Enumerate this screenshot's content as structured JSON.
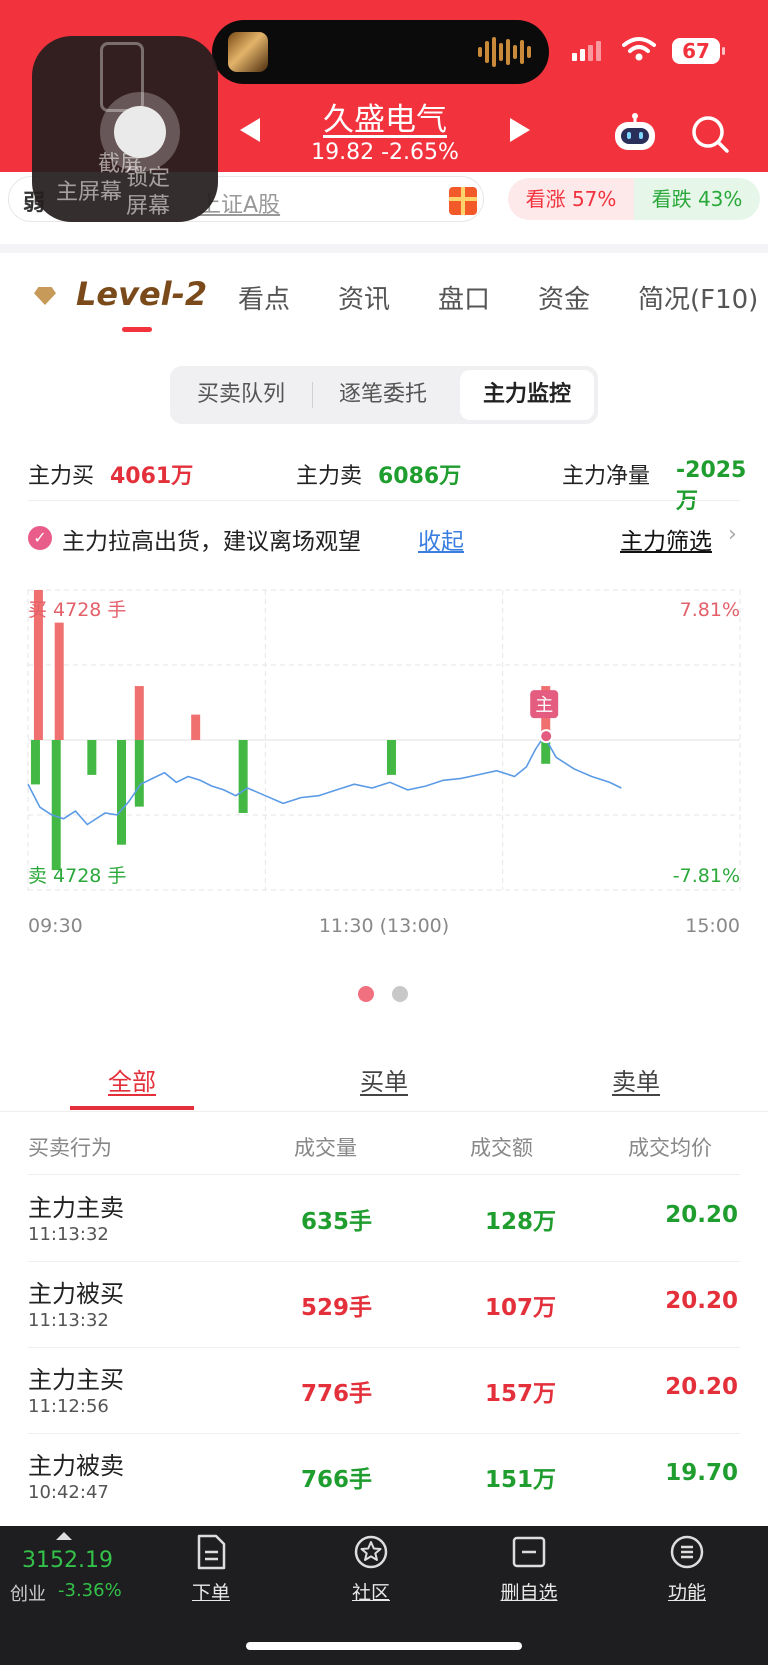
{
  "status_bar": {
    "battery": "67"
  },
  "header": {
    "stock_name": "久盛电气",
    "stock_price": "19.82 -2.65%",
    "icons": {
      "prev": "triangle-left-icon",
      "next": "triangle-right-icon",
      "assistant": "robot-icon",
      "search": "search-icon"
    }
  },
  "assistive_overlay": {
    "screenshot_label": "截屏",
    "lock_label": "锁定",
    "home_label": "主屏幕",
    "screen_label": "屏幕"
  },
  "search_strip": {
    "lead_char": "弱",
    "placeholder": "上证A股",
    "vote_up": "看涨 57%",
    "vote_down": "看跌 43%"
  },
  "tabs": {
    "items": [
      {
        "label": "Level-2",
        "active": true
      },
      {
        "label": "看点"
      },
      {
        "label": "资讯"
      },
      {
        "label": "盘口"
      },
      {
        "label": "资金"
      },
      {
        "label": "简况(F10)"
      }
    ]
  },
  "segment": {
    "items": [
      "买卖队列",
      "逐笔委托",
      "主力监控"
    ],
    "active_index": 2
  },
  "summary": {
    "buy_label": "主力买",
    "buy_value": "4061万",
    "sell_label": "主力卖",
    "sell_value": "6086万",
    "net_label": "主力净量",
    "net_value": "-2025万"
  },
  "alert": {
    "message": "主力拉高出货，建议离场观望",
    "fold": "收起",
    "filter": "主力筛选"
  },
  "chart_data": {
    "type": "bar",
    "top_left_label": "买 4728 手",
    "bottom_left_label": "卖 4728 手",
    "top_right_label": "7.81%",
    "bottom_right_label": "-7.81%",
    "x_ticks": [
      "09:30",
      "11:30 (13:00)",
      "15:00"
    ],
    "marker_label": "主",
    "volume_range": [
      -4728,
      4728
    ],
    "pct_range": [
      -7.81,
      7.81
    ],
    "buy_bars": [
      {
        "t": 2,
        "v": 4728
      },
      {
        "t": 9,
        "v": 3700
      },
      {
        "t": 36,
        "v": 1700
      },
      {
        "t": 55,
        "v": 800
      },
      {
        "t": 173,
        "v": 1700
      }
    ],
    "sell_bars": [
      {
        "t": 1,
        "v": 1400
      },
      {
        "t": 8,
        "v": 4100
      },
      {
        "t": 20,
        "v": 1100
      },
      {
        "t": 30,
        "v": 3300
      },
      {
        "t": 36,
        "v": 2100
      },
      {
        "t": 71,
        "v": 2300
      },
      {
        "t": 121,
        "v": 1100
      },
      {
        "t": 173,
        "v": 750
      }
    ],
    "price_line": [
      [
        0,
        -2.3
      ],
      [
        4,
        -3.5
      ],
      [
        8,
        -3.9
      ],
      [
        12,
        -4.1
      ],
      [
        16,
        -3.7
      ],
      [
        20,
        -4.4
      ],
      [
        26,
        -3.8
      ],
      [
        30,
        -3.9
      ],
      [
        34,
        -3.2
      ],
      [
        38,
        -2.3
      ],
      [
        42,
        -2.0
      ],
      [
        46,
        -1.7
      ],
      [
        50,
        -2.2
      ],
      [
        54,
        -1.9
      ],
      [
        58,
        -2.1
      ],
      [
        62,
        -2.4
      ],
      [
        66,
        -2.6
      ],
      [
        70,
        -2.9
      ],
      [
        74,
        -2.5
      ],
      [
        80,
        -2.9
      ],
      [
        86,
        -3.3
      ],
      [
        92,
        -3.0
      ],
      [
        98,
        -2.9
      ],
      [
        104,
        -2.6
      ],
      [
        110,
        -2.3
      ],
      [
        116,
        -2.5
      ],
      [
        122,
        -2.2
      ],
      [
        128,
        -2.6
      ],
      [
        134,
        -2.4
      ],
      [
        140,
        -2.1
      ],
      [
        146,
        -2.0
      ],
      [
        152,
        -1.8
      ],
      [
        158,
        -1.6
      ],
      [
        164,
        -1.9
      ],
      [
        168,
        -1.4
      ],
      [
        171,
        -0.5
      ],
      [
        174,
        0.2
      ],
      [
        178,
        -0.9
      ],
      [
        184,
        -1.5
      ],
      [
        190,
        -1.9
      ],
      [
        196,
        -2.2
      ],
      [
        200,
        -2.5
      ]
    ]
  },
  "order_tabs": {
    "items": [
      "全部",
      "买单",
      "卖单"
    ],
    "active_index": 0
  },
  "table": {
    "headers": [
      "买卖行为",
      "成交量",
      "成交额",
      "成交均价"
    ],
    "rows": [
      {
        "action": "主力主卖",
        "time": "11:13:32",
        "volume": "635手",
        "amount": "128万",
        "avg": "20.20",
        "vol_color": "green",
        "amt_color": "green",
        "avg_color": "green"
      },
      {
        "action": "主力被买",
        "time": "11:13:32",
        "volume": "529手",
        "amount": "107万",
        "avg": "20.20",
        "vol_color": "red",
        "amt_color": "red",
        "avg_color": "red"
      },
      {
        "action": "主力主买",
        "time": "11:12:56",
        "volume": "776手",
        "amount": "157万",
        "avg": "20.20",
        "vol_color": "red",
        "amt_color": "red",
        "avg_color": "red"
      },
      {
        "action": "主力被卖",
        "time": "10:42:47",
        "volume": "766手",
        "amount": "151万",
        "avg": "19.70",
        "vol_color": "green",
        "amt_color": "green",
        "avg_color": "green"
      }
    ]
  },
  "bottom_bar": {
    "index_value": "3152.19",
    "index_name": "创业",
    "index_change": "-3.36%",
    "buttons": [
      {
        "label": "下单",
        "icon": "order-form-icon"
      },
      {
        "label": "社区",
        "icon": "community-star-icon"
      },
      {
        "label": "删自选",
        "icon": "remove-watchlist-icon"
      },
      {
        "label": "功能",
        "icon": "menu-icon"
      }
    ]
  },
  "colors": {
    "header_red": "#f2333e",
    "rise": "#e3303a",
    "fall": "#1f9d2e",
    "bar_buy": "#f07070",
    "bar_sell": "#44b844",
    "price_line": "#5b9be6"
  }
}
